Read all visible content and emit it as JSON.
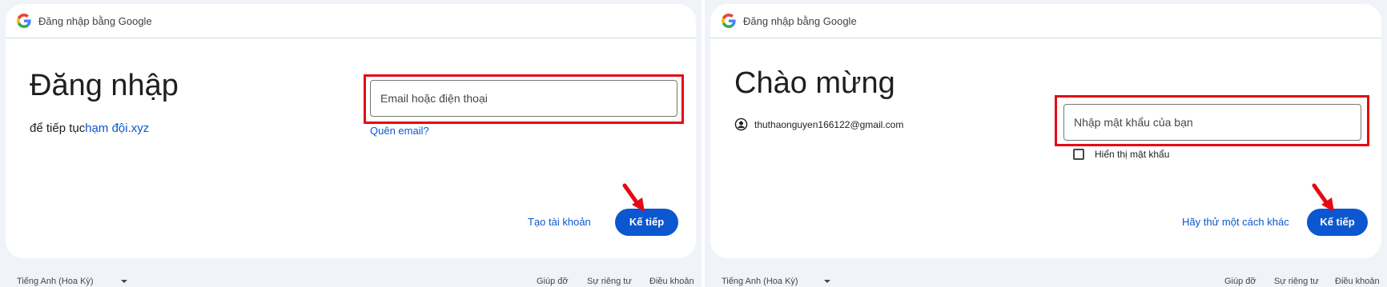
{
  "colors": {
    "accent": "#0b57d0",
    "highlight": "#e50914",
    "background": "#f0f4f9"
  },
  "left_panel": {
    "header_title": "Đăng nhập bằng Google",
    "heading": "Đăng nhập",
    "subtitle_prefix": "để tiếp tục",
    "subtitle_link": "hạm đội.xyz",
    "input_placeholder": "Email hoặc điện thoại",
    "forgot_email": "Quên email?",
    "create_account": "Tạo tài khoản",
    "next_button": "Kế tiếp",
    "footer": {
      "language": "Tiếng Anh (Hoa Kỳ)",
      "help": "Giúp đỡ",
      "privacy": "Sự riêng tư",
      "terms": "Điều khoản"
    }
  },
  "right_panel": {
    "header_title": "Đăng nhập bằng Google",
    "heading": "Chào mừng",
    "account_email": "thuthaonguyen166122@gmail.com",
    "input_placeholder": "Nhập mật khẩu của bạn",
    "show_password": "Hiển thị mật khẩu",
    "try_another_way": "Hãy thử một cách khác",
    "next_button": "Kế tiếp",
    "footer": {
      "language": "Tiếng Anh (Hoa Kỳ)",
      "help": "Giúp đỡ",
      "privacy": "Sự riêng tư",
      "terms": "Điều khoản"
    }
  },
  "icons": {
    "logo": "google-g-icon",
    "account": "account-circle-icon",
    "arrow": "red-arrow-icon",
    "dropdown": "caret-down-icon"
  }
}
